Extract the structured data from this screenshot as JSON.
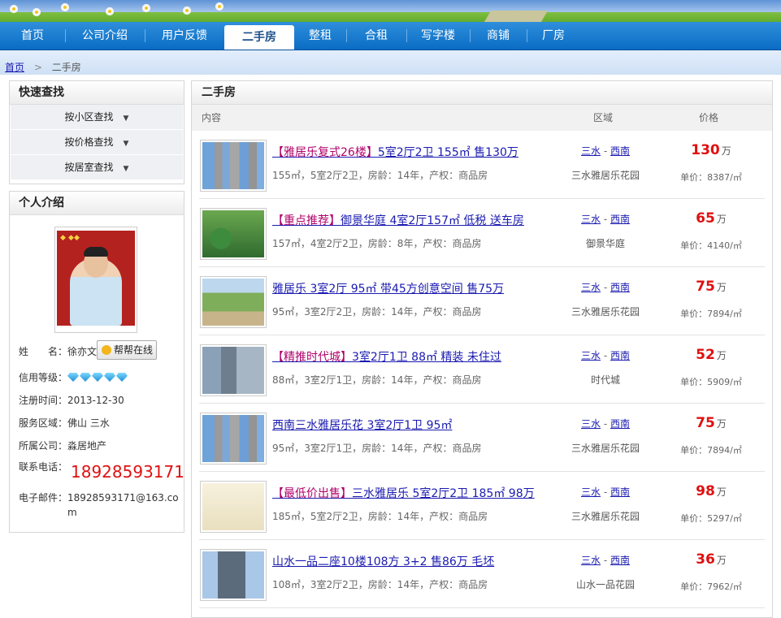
{
  "nav": [
    {
      "label": "首页",
      "active": false
    },
    {
      "label": "公司介绍",
      "active": false
    },
    {
      "label": "用户反馈",
      "active": false
    },
    {
      "label": "二手房",
      "active": true
    },
    {
      "label": "整租",
      "active": false
    },
    {
      "label": "合租",
      "active": false
    },
    {
      "label": "写字楼",
      "active": false
    },
    {
      "label": "商铺",
      "active": false
    },
    {
      "label": "厂房",
      "active": false
    }
  ],
  "breadcrumb": {
    "home": "首页",
    "sep": ">",
    "current": "二手房"
  },
  "quick_search": {
    "title": "快速查找",
    "items": [
      "按小区查找",
      "按价格查找",
      "按居室查找"
    ]
  },
  "profile": {
    "title": "个人介绍",
    "name_label": "姓　　名：",
    "name": "徐亦文",
    "online_button": "帮帮在线",
    "credit_label": "信用等级：",
    "credit_diamonds": 5,
    "register_label": "注册时间：",
    "register_date": "2013-12-30",
    "service_label": "服务区域：",
    "service_area": "佛山 三水",
    "company_label": "所属公司：",
    "company": "淼居地产",
    "phone_label": "联系电话：",
    "phone": "18928593171",
    "email_label": "电子邮件：",
    "email_line1": "18928593171@163.co",
    "email_line2": "m"
  },
  "listing": {
    "title": "二手房",
    "col_content": "内容",
    "col_area": "区域",
    "col_price": "价格",
    "price_unit": "万",
    "unit_price_label": "单价：",
    "rows": [
      {
        "title_red": "【雅居乐复式26楼】",
        "title_rest": "5室2厅2卫 155㎡ 售130万",
        "meta": "155㎡，5室2厅2卫，房龄：14年，产权：商品房",
        "district": "三水",
        "sub": "西南",
        "estate": "三水雅居乐花园",
        "price": "130",
        "unit_price": "8387/㎡",
        "thumb": "building"
      },
      {
        "title_red": "【重点推荐】",
        "title_rest": "御景华庭 4室2厅157㎡ 低税 送车房",
        "meta": "157㎡，4室2厅2卫，房龄：8年，产权：商品房",
        "district": "三水",
        "sub": "西南",
        "estate": "御景华庭",
        "price": "65",
        "unit_price": "4140/㎡",
        "thumb": "garden"
      },
      {
        "title_red": "",
        "title_rest": "雅居乐 3室2厅 95㎡ 带45方创意空间 售75万",
        "meta": "95㎡，3室2厅2卫，房龄：14年，产权：商品房",
        "district": "三水",
        "sub": "西南",
        "estate": "三水雅居乐花园",
        "price": "75",
        "unit_price": "7894/㎡",
        "thumb": "park"
      },
      {
        "title_red": "【精推时代城】",
        "title_rest": "3室2厅1卫 88㎡ 精装 未住过",
        "meta": "88㎡，3室2厅1卫，房龄：14年，产权：商品房",
        "district": "三水",
        "sub": "西南",
        "estate": "时代城",
        "price": "52",
        "unit_price": "5909/㎡",
        "thumb": "street"
      },
      {
        "title_red": "",
        "title_rest": "西南三水雅居乐花 3室2厅1卫 95㎡",
        "meta": "95㎡，3室2厅1卫，房龄：14年，产权：商品房",
        "district": "三水",
        "sub": "西南",
        "estate": "三水雅居乐花园",
        "price": "75",
        "unit_price": "7894/㎡",
        "thumb": "building"
      },
      {
        "title_red": "【最低价出售】",
        "title_rest": "三水雅居乐 5室2厅2卫 185㎡ 98万",
        "meta": "185㎡，5室2厅2卫，房龄：14年，产权：商品房",
        "district": "三水",
        "sub": "西南",
        "estate": "三水雅居乐花园",
        "price": "98",
        "unit_price": "5297/㎡",
        "thumb": "plan"
      },
      {
        "title_red": "",
        "title_rest": "山水一品二座10楼108方 3+2 售86万 毛坯",
        "meta": "108㎡，3室2厅2卫，房龄：14年，产权：商品房",
        "district": "三水",
        "sub": "西南",
        "estate": "山水一品花园",
        "price": "36",
        "unit_price": "7962/㎡",
        "thumb": "tower"
      }
    ]
  }
}
